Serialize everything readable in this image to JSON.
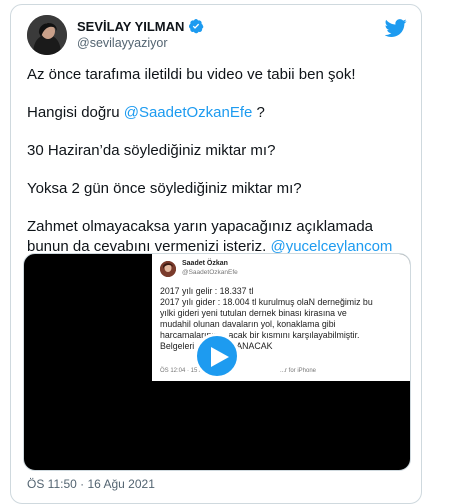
{
  "tweet": {
    "author_name": "SEVİLAY YILMAN",
    "author_handle": "@sevilayyaziyor",
    "paragraphs": [
      {
        "text": "Az önce tarafıma iletildi bu video ve tabii ben şok!"
      },
      {
        "text_before": "Hangisi doğru ",
        "mention": "@SaadetOzkanEfe",
        "text_after": " ?"
      },
      {
        "text": "30 Haziran’da söylediğiniz miktar mı?"
      },
      {
        "text": "Yoksa 2 gün önce söylediğiniz miktar mı?"
      },
      {
        "text_before": "Zahmet olmayacaksa yarın yapacağınız açıklamada bunun da cevabını vermenizi isteriz. ",
        "mention": "@yucelceylancom",
        "text_after": ""
      }
    ],
    "timestamp": "ÖS 11:50 · 16 Ağu 2021"
  },
  "video_screenshot": {
    "name": "Saadet Özkan",
    "handle": "@SaadetOzkanEfe",
    "line1": "2017 yılı gelir  : 18.337 tl",
    "line2": "2017 yılı gider  : 18.004 tl kurulmuş olaN  derneğimiz bu",
    "line3": "yılki gideri yeni tutulan dernek binası kirasına ve",
    "line4": "mudahil olunan  davaların yol, konaklama gibi",
    "line5": "harcamalarının ...acak bir kısmını karşılayabilmiştir.",
    "line6": "Belgeleri ... YAYINLANACAK",
    "meta_time": "ÖS 12:04 · 15 A",
    "meta_source": "...r for iPhone"
  },
  "icons": {
    "verified": "verified-badge-icon",
    "logo": "twitter-bird-icon",
    "play": "play-icon"
  },
  "colors": {
    "accent": "#1d9bf0",
    "text": "#0f1419",
    "secondary": "#536471"
  }
}
